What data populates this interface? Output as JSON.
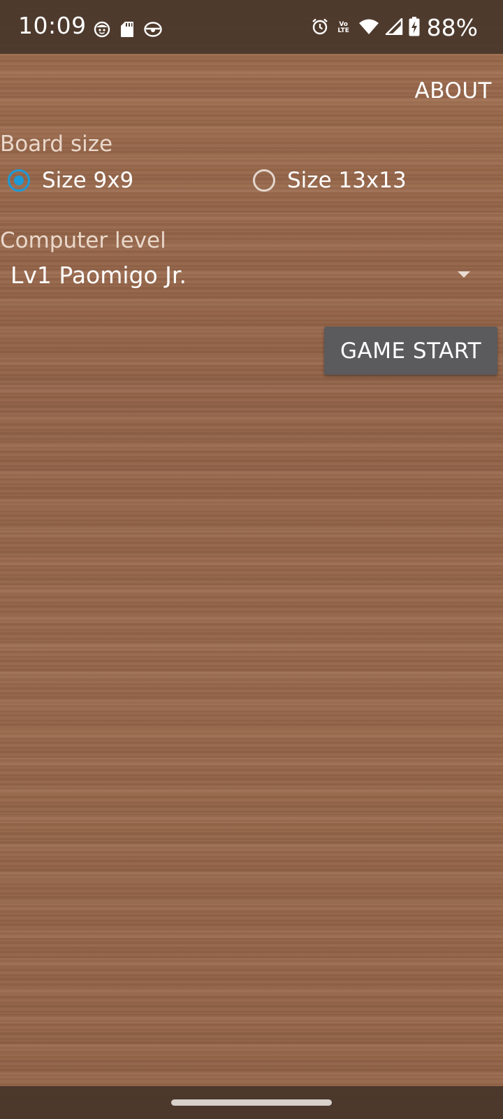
{
  "status_bar": {
    "time": "10:09",
    "notification_icons": [
      "face-icon",
      "sd-card-icon",
      "game-controller-icon"
    ],
    "system_icons": [
      "alarm-icon",
      "volte-icon",
      "wifi-icon",
      "cell-signal-icon",
      "battery-charging-icon"
    ],
    "volte_top": "Vo",
    "volte_bottom": "LTE",
    "battery_percent": "88%"
  },
  "header": {
    "about_label": "ABOUT"
  },
  "board_size": {
    "label": "Board size",
    "options": [
      {
        "label": "Size 9x9",
        "checked": true
      },
      {
        "label": "Size 13x13",
        "checked": false
      }
    ]
  },
  "computer_level": {
    "label": "Computer level",
    "selected": "Lv1 Paomigo Jr."
  },
  "actions": {
    "game_start_label": "GAME START"
  },
  "colors": {
    "accent": "#1e9ad6",
    "button_bg": "#5b5a5c",
    "wood": "#9a6a4c"
  }
}
